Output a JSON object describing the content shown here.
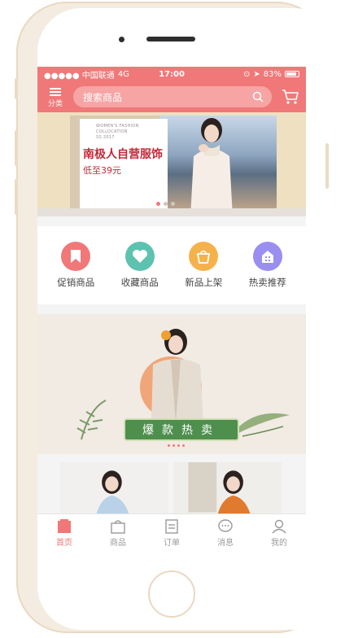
{
  "status_bar": {
    "carrier": "●●●●● 中国联通",
    "network": "4G",
    "time": "17:00",
    "battery": "83%",
    "battery_level_percent": 83
  },
  "header": {
    "menu_label": "分类",
    "search_placeholder": "搜索商品",
    "cart_icon": "cart-icon"
  },
  "banner": {
    "en_line1": "WOMEN'S FASHION",
    "en_line2": "COLLOCATION",
    "en_line3": "SS 2017",
    "title": "南极人自营服饰",
    "subtitle": "低至39元"
  },
  "categories": [
    {
      "label": "促销商品",
      "icon": "bookmark-icon",
      "color": "#f07878"
    },
    {
      "label": "收藏商品",
      "icon": "heart-icon",
      "color": "#5ec2b0"
    },
    {
      "label": "新品上架",
      "icon": "bag-icon",
      "color": "#f5b24a"
    },
    {
      "label": "热卖推荐",
      "icon": "building-icon",
      "color": "#9a8ef0"
    }
  ],
  "hot_banner": {
    "title": "爆款热卖"
  },
  "tab_bar": [
    {
      "label": "首页",
      "icon": "home-icon",
      "active": true
    },
    {
      "label": "商品",
      "icon": "shopping-bag-icon",
      "active": false
    },
    {
      "label": "订单",
      "icon": "order-icon",
      "active": false
    },
    {
      "label": "消息",
      "icon": "message-icon",
      "active": false
    },
    {
      "label": "我的",
      "icon": "user-icon",
      "active": false
    }
  ],
  "colors": {
    "accent": "#f07878",
    "phone_shell": "#f4ece0"
  }
}
